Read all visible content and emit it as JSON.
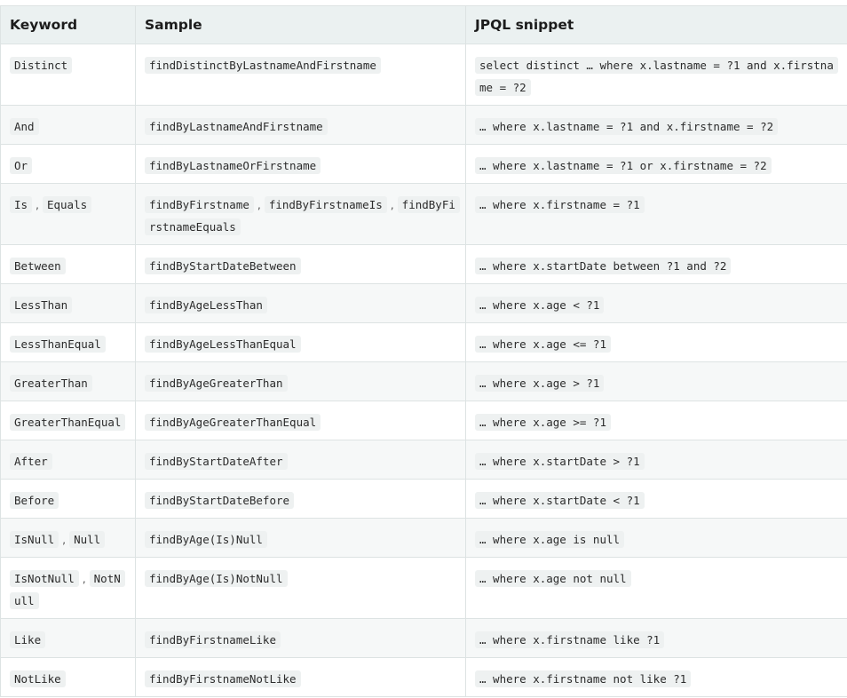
{
  "table": {
    "headers": [
      "Keyword",
      "Sample",
      "JPQL snippet"
    ],
    "rows": [
      {
        "keywords": [
          "Distinct"
        ],
        "samples": [
          "findDistinctByLastnameAndFirstname"
        ],
        "jpql": "select distinct … where x.lastname = ?1 and x.firstname = ?2",
        "tall": true
      },
      {
        "keywords": [
          "And"
        ],
        "samples": [
          "findByLastnameAndFirstname"
        ],
        "jpql": "… where x.lastname = ?1 and x.firstname = ?2"
      },
      {
        "keywords": [
          "Or"
        ],
        "samples": [
          "findByLastnameOrFirstname"
        ],
        "jpql": "… where x.lastname = ?1 or x.firstname = ?2"
      },
      {
        "keywords": [
          "Is",
          "Equals"
        ],
        "samples": [
          "findByFirstname",
          "findByFirstnameIs",
          "findByFirstnameEquals"
        ],
        "jpql": "… where x.firstname = ?1",
        "tall": true
      },
      {
        "keywords": [
          "Between"
        ],
        "samples": [
          "findByStartDateBetween"
        ],
        "jpql": "… where x.startDate between ?1 and ?2"
      },
      {
        "keywords": [
          "LessThan"
        ],
        "samples": [
          "findByAgeLessThan"
        ],
        "jpql": "… where x.age < ?1"
      },
      {
        "keywords": [
          "LessThanEqual"
        ],
        "samples": [
          "findByAgeLessThanEqual"
        ],
        "jpql": "… where x.age <= ?1"
      },
      {
        "keywords": [
          "GreaterThan"
        ],
        "samples": [
          "findByAgeGreaterThan"
        ],
        "jpql": "… where x.age > ?1"
      },
      {
        "keywords": [
          "GreaterThanEqual"
        ],
        "samples": [
          "findByAgeGreaterThanEqual"
        ],
        "jpql": "… where x.age >= ?1"
      },
      {
        "keywords": [
          "After"
        ],
        "samples": [
          "findByStartDateAfter"
        ],
        "jpql": "… where x.startDate > ?1"
      },
      {
        "keywords": [
          "Before"
        ],
        "samples": [
          "findByStartDateBefore"
        ],
        "jpql": "… where x.startDate < ?1"
      },
      {
        "keywords": [
          "IsNull",
          "Null"
        ],
        "samples": [
          "findByAge(Is)Null"
        ],
        "jpql": "… where x.age is null"
      },
      {
        "keywords": [
          "IsNotNull",
          "NotNull"
        ],
        "samples": [
          "findByAge(Is)NotNull"
        ],
        "jpql": "… where x.age not null",
        "tall": true
      },
      {
        "keywords": [
          "Like"
        ],
        "samples": [
          "findByFirstnameLike"
        ],
        "jpql": "… where x.firstname like ?1"
      },
      {
        "keywords": [
          "NotLike"
        ],
        "samples": [
          "findByFirstnameNotLike"
        ],
        "jpql": "… where x.firstname not like ?1"
      }
    ]
  }
}
